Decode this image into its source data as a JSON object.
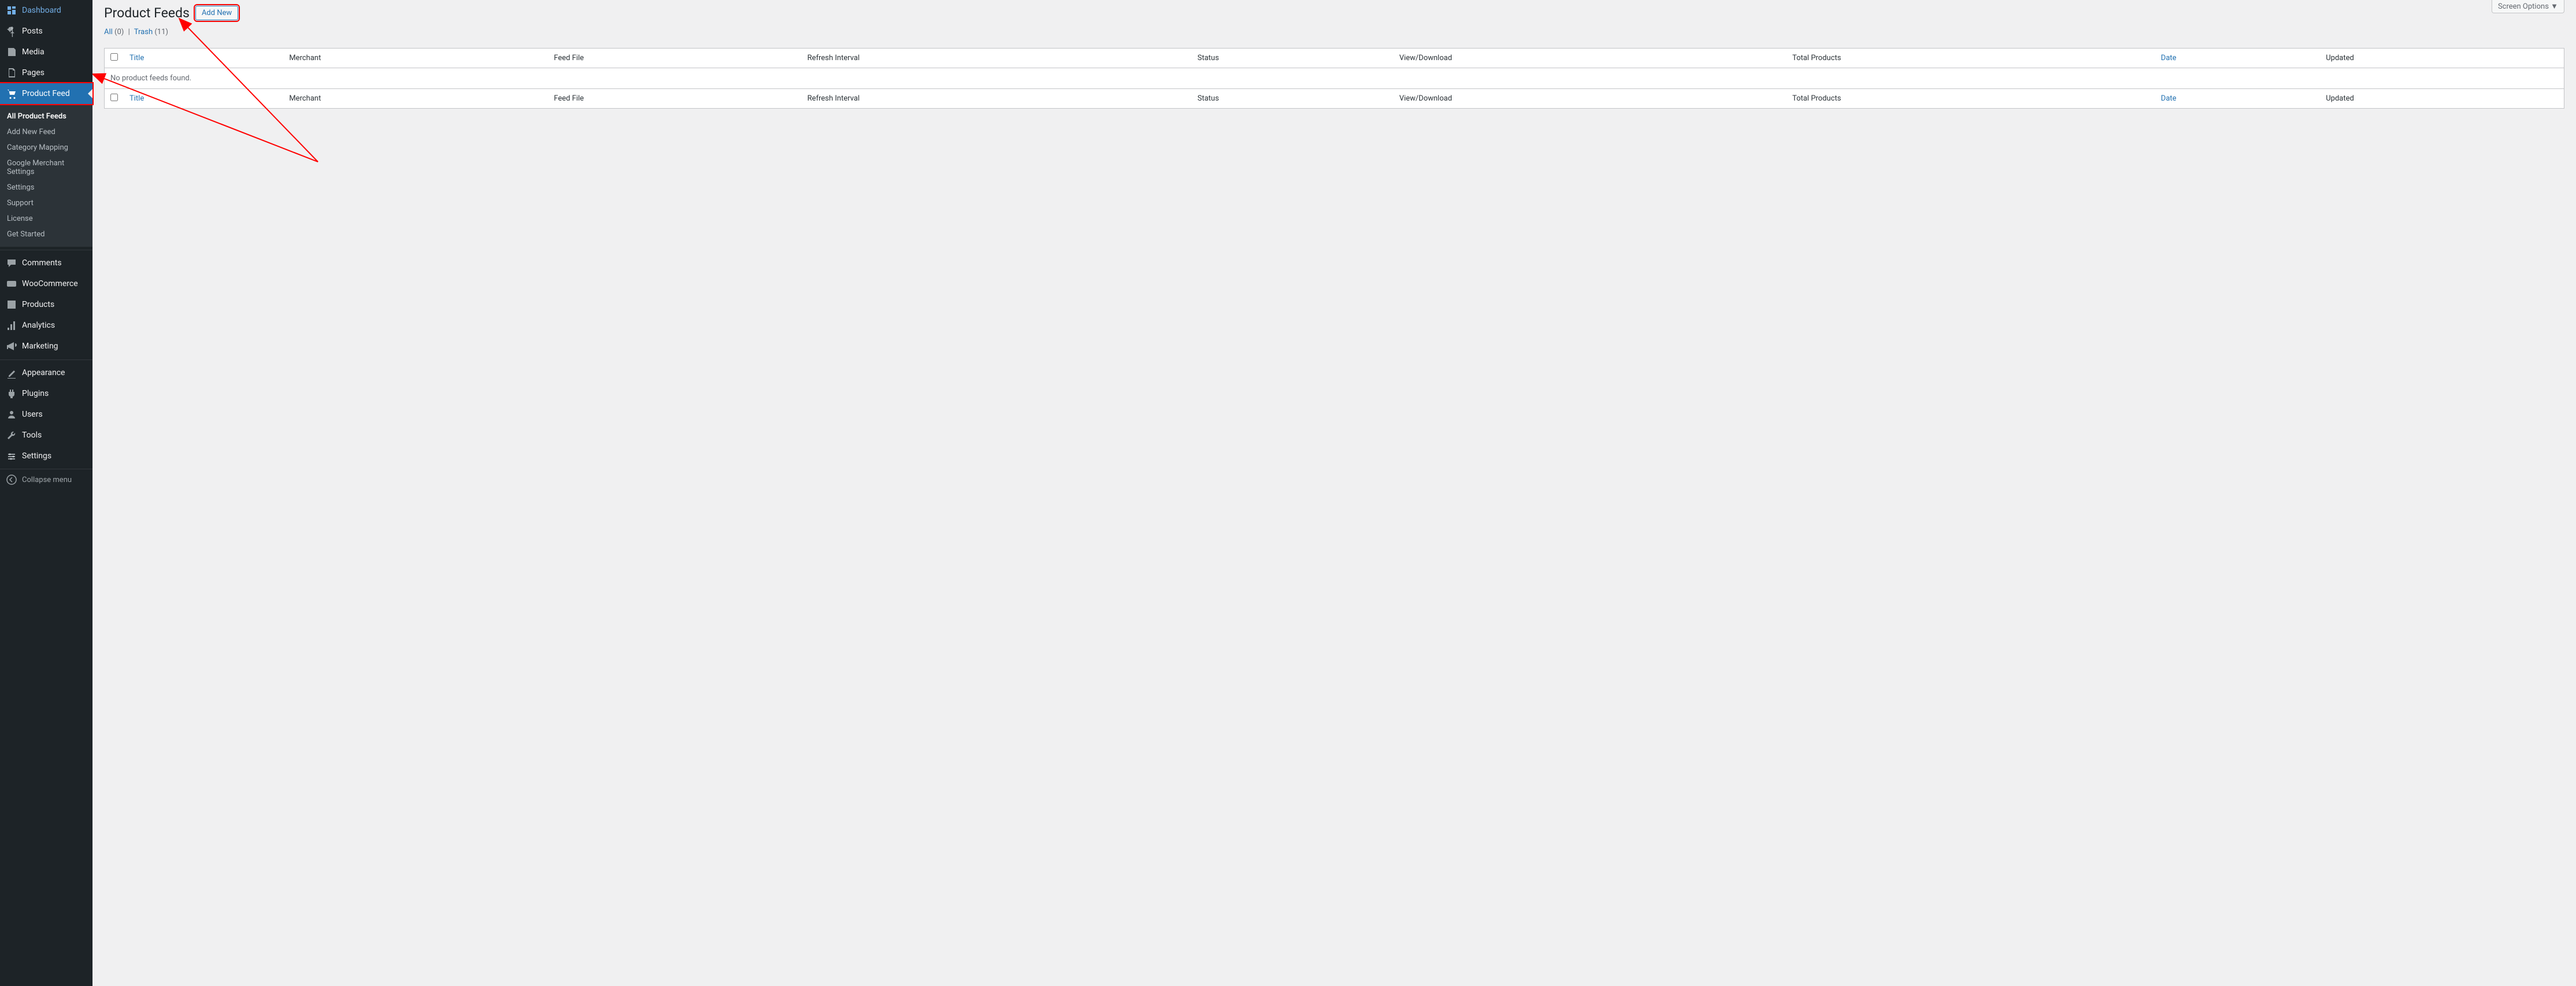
{
  "sidebar": {
    "items": [
      {
        "label": "Dashboard",
        "icon": "dashboard"
      },
      {
        "label": "Posts",
        "icon": "pin"
      },
      {
        "label": "Media",
        "icon": "media"
      },
      {
        "label": "Pages",
        "icon": "pages"
      },
      {
        "label": "Product Feed",
        "icon": "cart",
        "current": true,
        "highlighted": true
      },
      {
        "label": "Comments",
        "icon": "comments"
      },
      {
        "label": "WooCommerce",
        "icon": "woo"
      },
      {
        "label": "Products",
        "icon": "products"
      },
      {
        "label": "Analytics",
        "icon": "analytics"
      },
      {
        "label": "Marketing",
        "icon": "marketing"
      },
      {
        "label": "Appearance",
        "icon": "appearance"
      },
      {
        "label": "Plugins",
        "icon": "plugins"
      },
      {
        "label": "Users",
        "icon": "users"
      },
      {
        "label": "Tools",
        "icon": "tools"
      },
      {
        "label": "Settings",
        "icon": "settings"
      }
    ],
    "submenu": [
      {
        "label": "All Product Feeds",
        "active": true
      },
      {
        "label": "Add New Feed"
      },
      {
        "label": "Category Mapping"
      },
      {
        "label": "Google Merchant Settings"
      },
      {
        "label": "Settings"
      },
      {
        "label": "Support"
      },
      {
        "label": "License"
      },
      {
        "label": "Get Started"
      }
    ],
    "collapse_label": "Collapse menu"
  },
  "header": {
    "screen_options": "Screen Options",
    "title": "Product Feeds",
    "add_new": "Add New"
  },
  "filters": {
    "all_label": "All",
    "all_count": "(0)",
    "trash_label": "Trash",
    "trash_count": "(11)"
  },
  "table": {
    "columns": {
      "title": "Title",
      "merchant": "Merchant",
      "feed_file": "Feed File",
      "refresh_interval": "Refresh Interval",
      "status": "Status",
      "view_download": "View/Download",
      "total_products": "Total Products",
      "date": "Date",
      "updated": "Updated"
    },
    "no_items": "No product feeds found."
  }
}
